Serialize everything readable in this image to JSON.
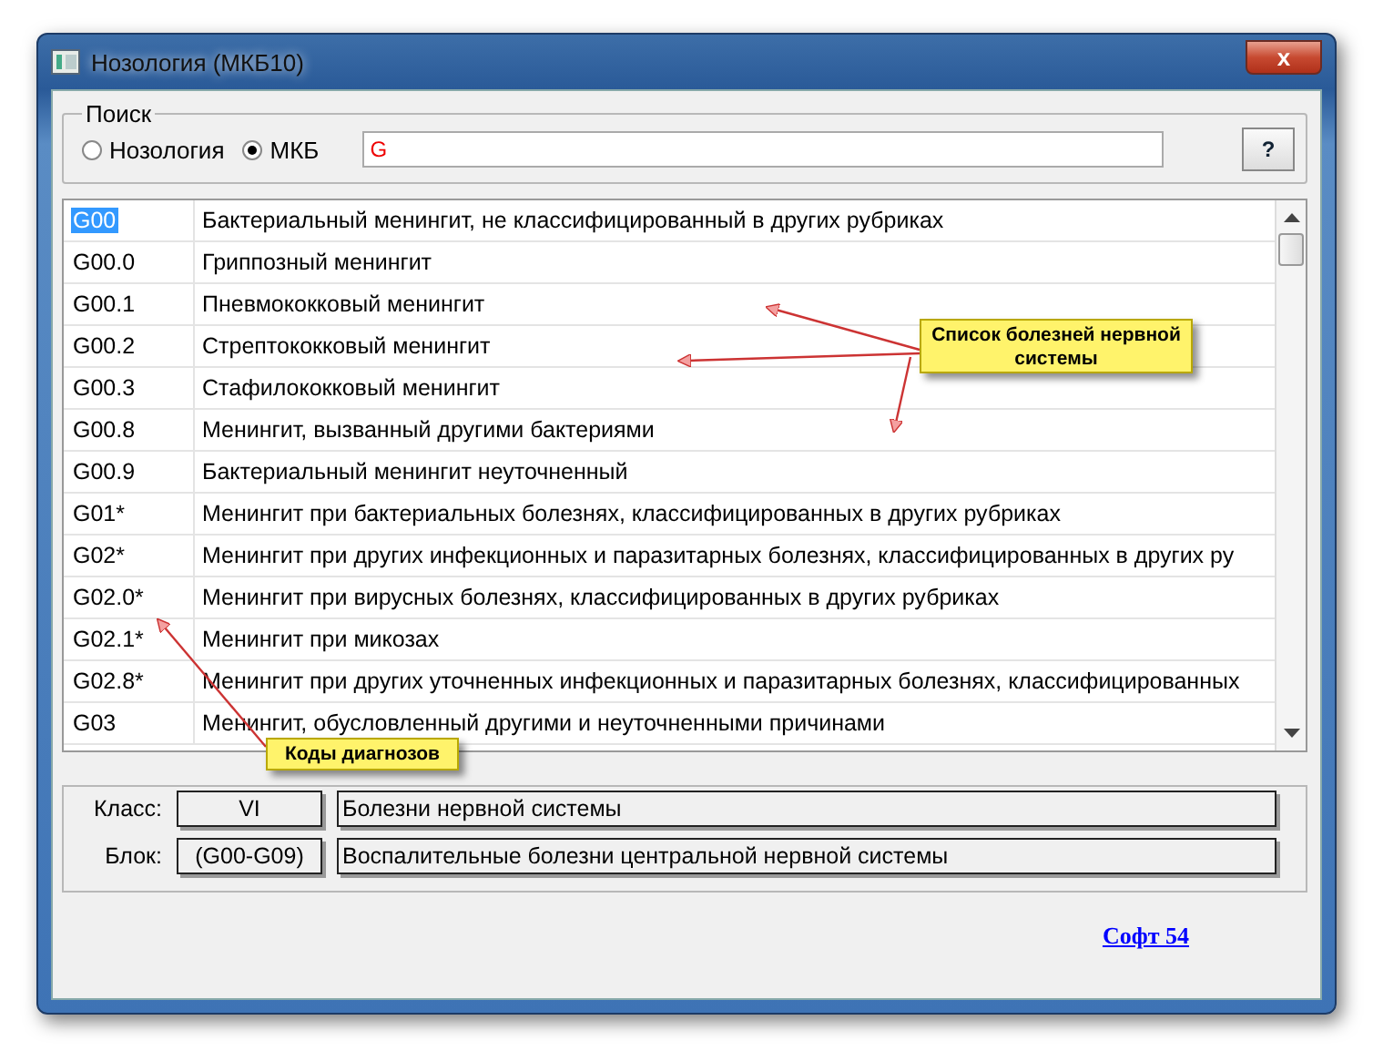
{
  "window": {
    "title": "Нозология (МКБ10)",
    "close": "x"
  },
  "search": {
    "legend": "Поиск",
    "modes": [
      {
        "label": "Нозология",
        "selected": false
      },
      {
        "label": "МКБ",
        "selected": true
      }
    ],
    "value": "G",
    "help_button": "?"
  },
  "rows": [
    {
      "code": "G00",
      "name": "Бактериальный менингит, не классифицированный в других рубриках",
      "selected": true
    },
    {
      "code": "G00.0",
      "name": "Гриппозный менингит",
      "selected": false
    },
    {
      "code": "G00.1",
      "name": "Пневмококковый менингит",
      "selected": false
    },
    {
      "code": "G00.2",
      "name": "Стрептококковый менингит",
      "selected": false
    },
    {
      "code": "G00.3",
      "name": "Стафилококковый менингит",
      "selected": false
    },
    {
      "code": "G00.8",
      "name": "Менингит, вызванный другими бактериями",
      "selected": false
    },
    {
      "code": "G00.9",
      "name": "Бактериальный менингит неуточненный",
      "selected": false
    },
    {
      "code": "G01*",
      "name": "Менингит при бактериальных болезнях, классифицированных в других рубриках",
      "selected": false
    },
    {
      "code": "G02*",
      "name": "Менингит при других инфекционных и паразитарных болезнях, классифицированных в других ру",
      "selected": false
    },
    {
      "code": "G02.0*",
      "name": "Менингит при вирусных болезнях, классифицированных в других рубриках",
      "selected": false
    },
    {
      "code": "G02.1*",
      "name": "Менингит при микозах",
      "selected": false
    },
    {
      "code": "G02.8*",
      "name": "Менингит при других уточненных инфекционных и паразитарных болезнях, классифицированных",
      "selected": false
    },
    {
      "code": "G03",
      "name": "Менингит, обусловленный другими и неуточненными причинами",
      "selected": false
    }
  ],
  "details": [
    {
      "label": "Класс:",
      "code": "VI",
      "name": "Болезни нервной системы"
    },
    {
      "label": "Блок:",
      "code": "(G00-G09)",
      "name": "Воспалительные болезни центральной нервной системы"
    }
  ],
  "link": "Софт 54",
  "callouts": [
    {
      "text": "Список болезней нервной системы"
    },
    {
      "text": "Коды диагнозов"
    }
  ]
}
